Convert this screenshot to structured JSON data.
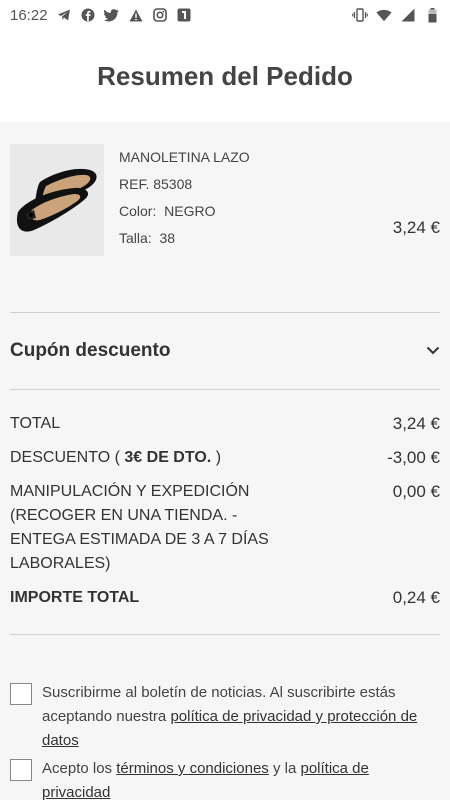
{
  "status_bar": {
    "time": "16:22",
    "icons": [
      "telegram-icon",
      "facebook-icon",
      "twitter-icon",
      "warning-icon",
      "instagram-icon",
      "app-icon"
    ],
    "right_icons": [
      "vibrate-icon",
      "wifi-icon",
      "signal-icon",
      "battery-icon"
    ]
  },
  "header": {
    "title": "Resumen del Pedido"
  },
  "product": {
    "name": "MANOLETINA LAZO",
    "ref_label": "REF.",
    "ref_value": "85308",
    "color_label": "Color:",
    "color_value": "NEGRO",
    "size_label": "Talla:",
    "size_value": "38",
    "price": "3,24 €"
  },
  "coupon": {
    "title": "Cupón descuento"
  },
  "summary": {
    "total_label": "TOTAL",
    "total_value": "3,24 €",
    "discount_prefix": "DESCUENTO (",
    "discount_code": "3€ DE DTO.",
    "discount_suffix": ")",
    "discount_value": "-3,00 €",
    "handling_label": "MANIPULACIÓN Y EXPEDICIÓN (RECOGER EN UNA TIENDA. - ENTEGA ESTIMADA DE 3 A 7 DÍAS LABORALES)",
    "handling_value": "0,00 €",
    "import_label": "IMPORTE TOTAL",
    "import_value": "0,24 €"
  },
  "newsletter": {
    "text": "Suscribirme al boletín de noticias. Al suscribirte estás aceptando nuestra ",
    "link": "política de privacidad y protección de datos"
  },
  "terms": {
    "prefix": "Acepto los ",
    "terms_link": "términos y condiciones",
    "middle": " y la ",
    "privacy_link": "política de privacidad"
  }
}
